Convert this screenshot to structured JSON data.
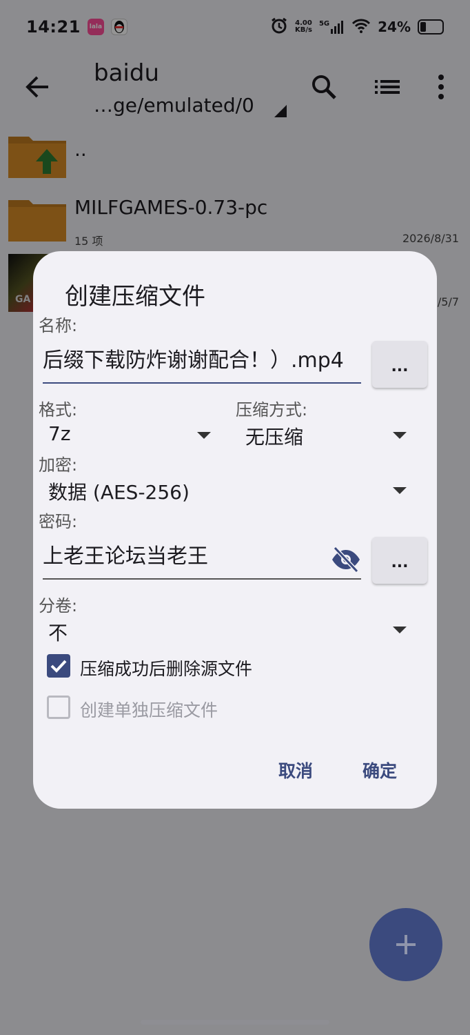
{
  "status": {
    "time": "14:21",
    "app_badge": "lala",
    "speed_value": "4.00",
    "speed_unit": "KB/s",
    "network": "5G",
    "battery": "24%"
  },
  "toolbar": {
    "title": "baidu",
    "path": "…ge/emulated/0"
  },
  "files": [
    {
      "name": "..",
      "meta": "",
      "date": ""
    },
    {
      "name": "MILFGAMES-0.73-pc",
      "meta": "15 项",
      "date": "2026/8/31"
    },
    {
      "name": "",
      "meta": "",
      "date": "/5/7",
      "thumb_text": "GA"
    }
  ],
  "dialog": {
    "title": "创建压缩文件",
    "name_label": "名称:",
    "name_value": "后缀下载防炸谢谢配合！）.mp4",
    "more_label": "...",
    "format_label": "格式:",
    "format_value": "7z",
    "method_label": "压缩方式:",
    "method_value": "无压缩",
    "encrypt_label": "加密:",
    "encrypt_value": "数据 (AES-256)",
    "password_label": "密码:",
    "password_value": "上老王论坛当老王",
    "split_label": "分卷:",
    "split_value": "不",
    "delete_source_label": "压缩成功后删除源文件",
    "delete_source_checked": true,
    "separate_label": "创建单独压缩文件",
    "separate_checked": false,
    "cancel_label": "取消",
    "ok_label": "确定"
  },
  "colors": {
    "accent": "#3b4a7e",
    "folder": "#c07a1f",
    "surface": "#f2f1f6"
  }
}
